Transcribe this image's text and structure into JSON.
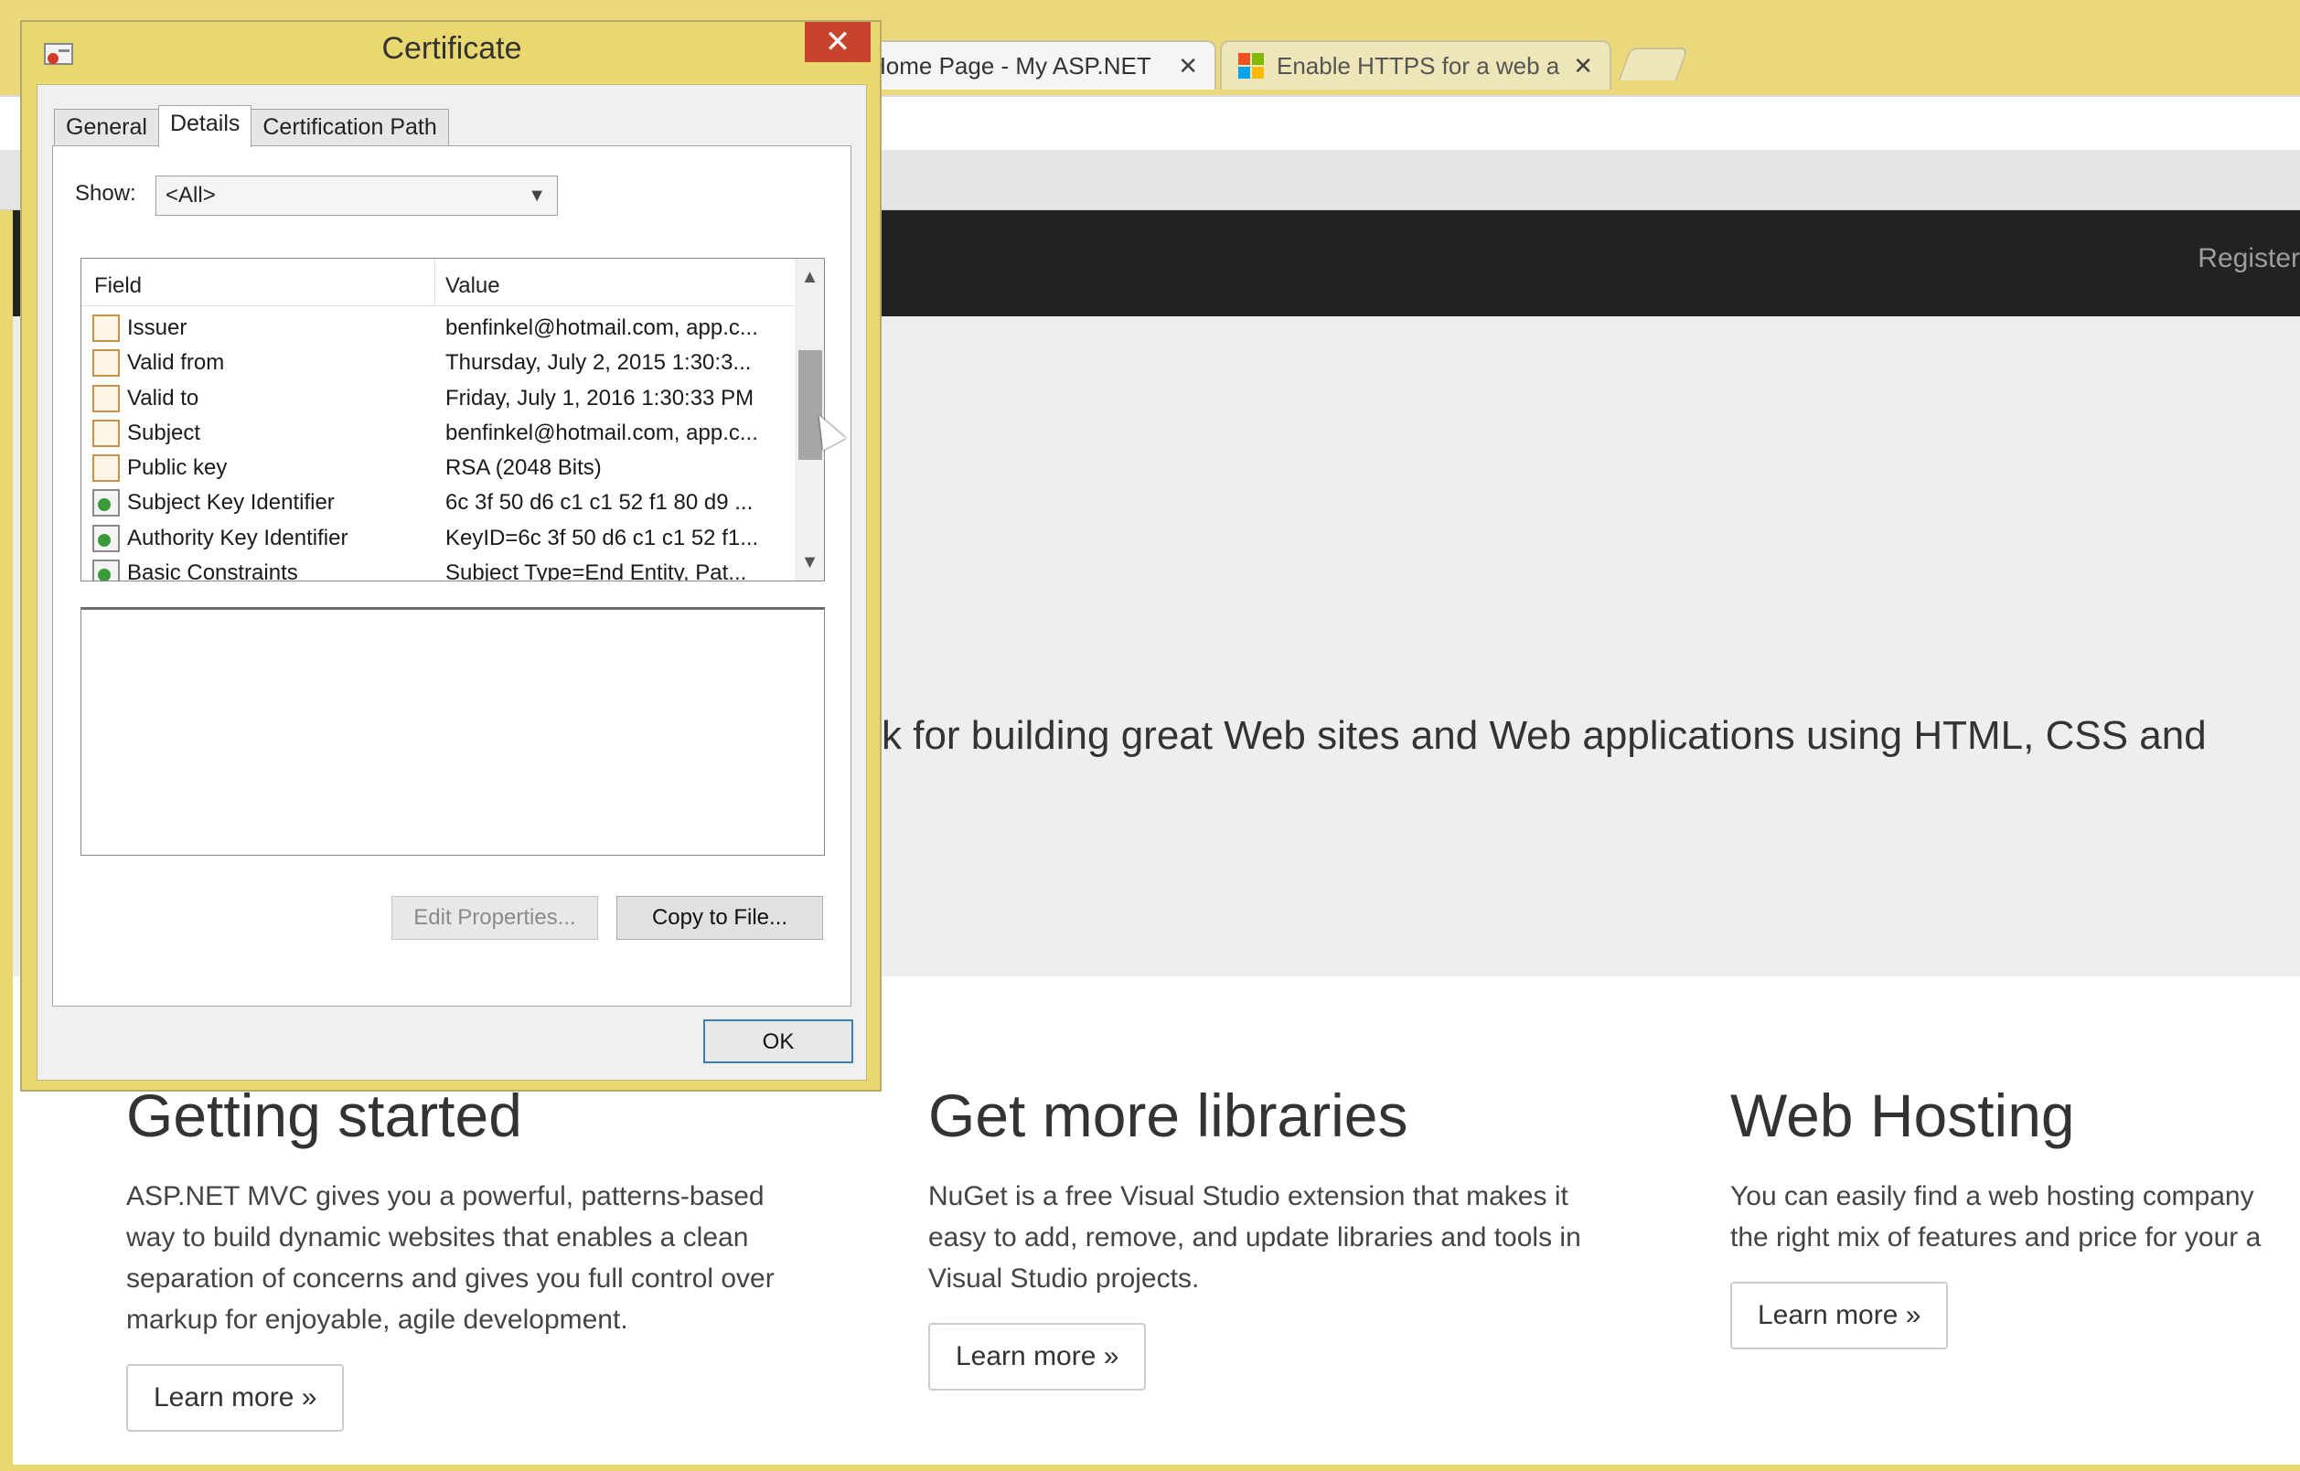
{
  "browser": {
    "tabs": [
      {
        "title": "Home Page - My ASP.NET",
        "close": "✕"
      },
      {
        "title": "Enable HTTPS for a web app",
        "close": "✕"
      }
    ]
  },
  "webpage": {
    "navbar": {
      "register": "Register"
    },
    "jumbotron": {
      "lead": "k for building great Web sites and Web applications using HTML, CSS and"
    },
    "columns": [
      {
        "heading": "Getting started",
        "lines": [
          "ASP.NET MVC gives you a powerful, patterns-based",
          "way to build dynamic websites that enables a clean",
          "separation of concerns and gives you full control over",
          "markup for enjoyable, agile development."
        ],
        "button": "Learn more »"
      },
      {
        "heading": "Get more libraries",
        "lines": [
          "NuGet is a free Visual Studio extension that makes it",
          "easy to add, remove, and update libraries and tools in",
          "Visual Studio projects."
        ],
        "button": "Learn more »"
      },
      {
        "heading": "Web Hosting",
        "lines": [
          "You can easily find a web hosting company",
          "the right mix of features and price for your a"
        ],
        "button": "Learn more »"
      }
    ]
  },
  "certificate_dialog": {
    "title": "Certificate",
    "close": "✕",
    "tabs": [
      "General",
      "Details",
      "Certification Path"
    ],
    "active_tab": "Details",
    "show_label": "Show:",
    "show_value": "<All>",
    "columns": {
      "field": "Field",
      "value": "Value"
    },
    "rows": [
      {
        "field": "Issuer",
        "value": "benfinkel@hotmail.com, app.c...",
        "icon": "certificate-field-icon"
      },
      {
        "field": "Valid from",
        "value": "Thursday, July 2, 2015 1:30:3...",
        "icon": "certificate-field-icon"
      },
      {
        "field": "Valid to",
        "value": "Friday, July 1, 2016 1:30:33 PM",
        "icon": "certificate-field-icon"
      },
      {
        "field": "Subject",
        "value": "benfinkel@hotmail.com, app.c...",
        "icon": "certificate-field-icon"
      },
      {
        "field": "Public key",
        "value": "RSA (2048 Bits)",
        "icon": "certificate-field-icon"
      },
      {
        "field": "Subject Key Identifier",
        "value": "6c 3f 50 d6 c1 c1 52 f1 80 d9 ...",
        "icon": "extension-icon"
      },
      {
        "field": "Authority Key Identifier",
        "value": "KeyID=6c 3f 50 d6 c1 c1 52 f1...",
        "icon": "extension-icon"
      },
      {
        "field": "Basic Constraints",
        "value": "Subject Type=End Entity, Pat...",
        "icon": "extension-icon"
      }
    ],
    "buttons": {
      "edit_properties": "Edit Properties...",
      "copy_to_file": "Copy to File...",
      "ok": "OK"
    }
  }
}
